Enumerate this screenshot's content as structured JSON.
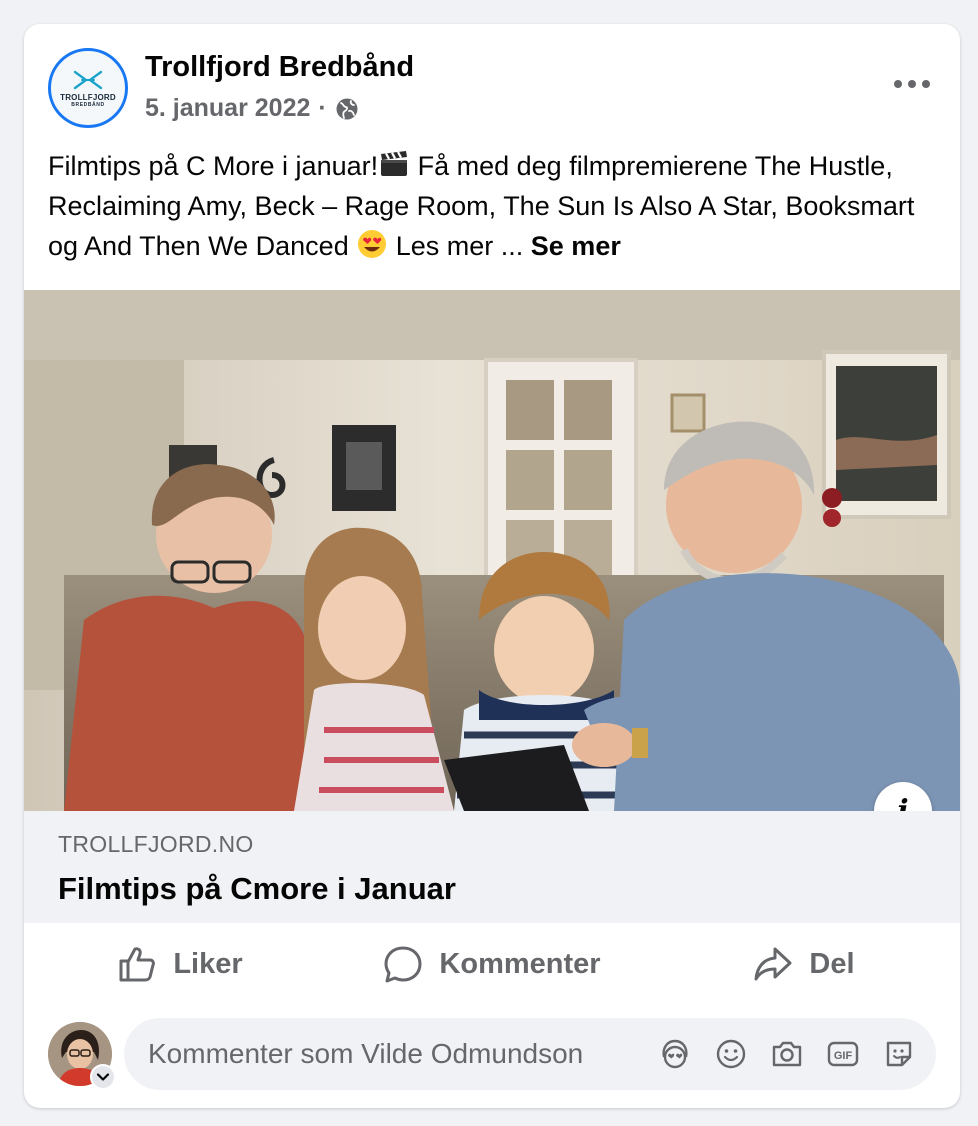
{
  "post": {
    "page_name": "Trollfjord Bredbånd",
    "logo": {
      "word": "TROLLFJORD",
      "sub": "BREDBÅND"
    },
    "date": "5. januar 2022",
    "separator": "·",
    "audience_icon": "globe-icon",
    "more_icon": "more-horizontal-icon",
    "text_before_emoji1": "Filmtips på C More i januar!",
    "emoji1": "clapper-board-emoji",
    "text_after_emoji1": " Få med deg filmpremierene The Hustle, Reclaiming Amy, Beck – Rage Room, The Sun Is Also A Star, Booksmart og And Then We Danced ",
    "emoji2": "heart-eyes-emoji",
    "text_after_emoji2": " Les mer ... ",
    "see_more": "Se mer"
  },
  "link_preview": {
    "domain": "TROLLFJORD.NO",
    "title": "Filmtips på Cmore i Januar",
    "info_label": "i"
  },
  "actions": [
    {
      "label": "Liker",
      "icon": "thumbs-up-icon"
    },
    {
      "label": "Kommenter",
      "icon": "comment-bubble-icon"
    },
    {
      "label": "Del",
      "icon": "share-arrow-icon"
    }
  ],
  "comment": {
    "placeholder": "Kommenter som Vilde Odmundson",
    "icons": [
      "avatar-sticker-icon",
      "emoji-icon",
      "camera-icon",
      "gif-icon",
      "sticker-icon"
    ]
  },
  "colors": {
    "accent": "#1877f2",
    "logo_teal": "#1ea4c9",
    "text_primary": "#050505",
    "text_secondary": "#65676b",
    "surface": "#f0f2f5"
  }
}
